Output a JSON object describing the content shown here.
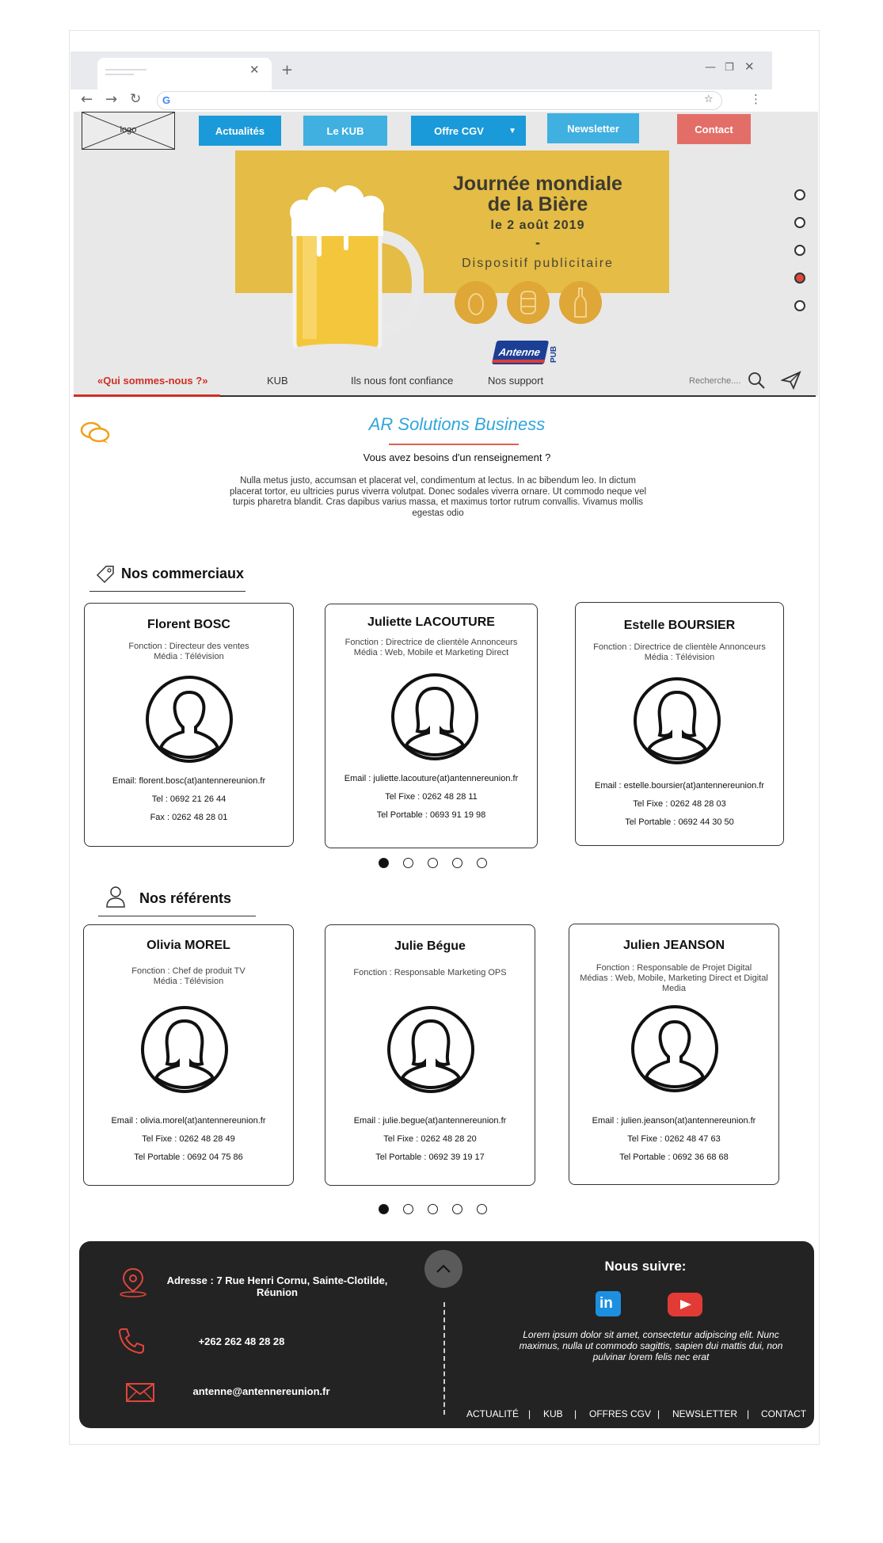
{
  "nav": {
    "logo": "logo",
    "buttons": [
      "Actualités",
      "Le KUB",
      "Offre CGV",
      "Newsletter",
      "Contact"
    ],
    "colors": {
      "blue": "#1a9ad8",
      "light_blue": "#3fb0e0",
      "contact": "#e36e68"
    }
  },
  "banner": {
    "title_line1": "Journée mondiale",
    "title_line2": "de la Bière",
    "date": "le 2 août 2019",
    "dash": "-",
    "subtitle": "Dispositif publicitaire",
    "brand": "Antenne",
    "brand_tag": "PUB",
    "slide_count": 5,
    "active_slide": 4
  },
  "subnav": {
    "items": [
      "«Qui sommes-nous ?»",
      "KUB",
      "Ils nous font confiance",
      "Nos support"
    ],
    "search_placeholder": "Recherche...."
  },
  "intro": {
    "title": "AR Solutions Business",
    "question": "Vous avez besoins d'un renseignement ?",
    "body": "Nulla metus justo, accumsan et placerat vel, condimentum at lectus. In ac bibendum leo. In dictum placerat tortor, eu ultricies purus viverra volutpat. Donec sodales viverra ornare. Ut commodo neque vel turpis pharetra blandit. Cras dapibus varius massa, et maximus tortor rutrum convallis. Vivamus mollis egestas odio"
  },
  "commerciaux": {
    "title": "Nos commerciaux",
    "cards": [
      {
        "name": "Florent BOSC",
        "role1": "Fonction : Directeur des ventes",
        "role2": "Média : Télévision",
        "email": "Email: florent.bosc(at)antennereunion.fr",
        "line2": "Tel : 0692 21 26 44",
        "line3": "Fax : 0262 48 28 01",
        "avatar": "male-avatar-icon"
      },
      {
        "name": "Juliette LACOUTURE",
        "role1": "Fonction : Directrice de clientèle Annonceurs",
        "role2": "Média : Web, Mobile et Marketing Direct",
        "email": "Email : juliette.lacouture(at)antennereunion.fr",
        "line2": "Tel Fixe : 0262 48 28 11",
        "line3": "Tel Portable : 0693 91 19 98",
        "avatar": "female-avatar-icon"
      },
      {
        "name": "Estelle BOURSIER",
        "role1": "Fonction : Directrice de clientèle Annonceurs",
        "role2": "Média : Télévision",
        "email": "Email : estelle.boursier(at)antennereunion.fr",
        "line2": "Tel Fixe : 0262 48 28 03",
        "line3": "Tel Portable : 0692 44 30 50",
        "avatar": "female-avatar-icon"
      }
    ]
  },
  "referents": {
    "title": "Nos référents",
    "cards": [
      {
        "name": "Olivia MOREL",
        "role1": "Fonction : Chef de produit TV",
        "role2": "Média : Télévision",
        "email": "Email : olivia.morel(at)antennereunion.fr",
        "line2": "Tel Fixe : 0262 48 28 49",
        "line3": "Tel Portable : 0692 04 75 86",
        "avatar": "female-avatar-icon"
      },
      {
        "name": "Julie Bégue",
        "role1": "Fonction : Responsable Marketing OPS",
        "role2": "",
        "email": "Email : julie.begue(at)antennereunion.fr",
        "line2": "Tel Fixe : 0262 48 28 20",
        "line3": "Tel Portable : 0692 39 19 17",
        "avatar": "female-avatar-icon"
      },
      {
        "name": "Julien JEANSON",
        "role1": "Fonction : Responsable de Projet Digital",
        "role2": "Médias : Web, Mobile, Marketing Direct et Digital Media",
        "email": "Email : julien.jeanson(at)antennereunion.fr",
        "line2": "Tel Fixe : 0262 48 47 63",
        "line3": "Tel Portable : 0692 36 68 68",
        "avatar": "male-avatar-icon"
      }
    ]
  },
  "footer": {
    "address": "Adresse : 7 Rue Henri Cornu, Sainte-Clotilde, Réunion",
    "phone": "+262 262 48 28 28",
    "email": "antenne@antennereunion.fr",
    "follow_title": "Nous suivre:",
    "follow_text": "Lorem ipsum dolor sit amet, consectetur adipiscing elit. Nunc maximus, nulla ut commodo sagittis, sapien dui mattis dui, non pulvinar lorem felis nec erat",
    "links": [
      "ACTUALITÉ",
      "KUB",
      "OFFRES CGV",
      "NEWSLETTER",
      "CONTACT"
    ],
    "accent": "#e0463c"
  }
}
